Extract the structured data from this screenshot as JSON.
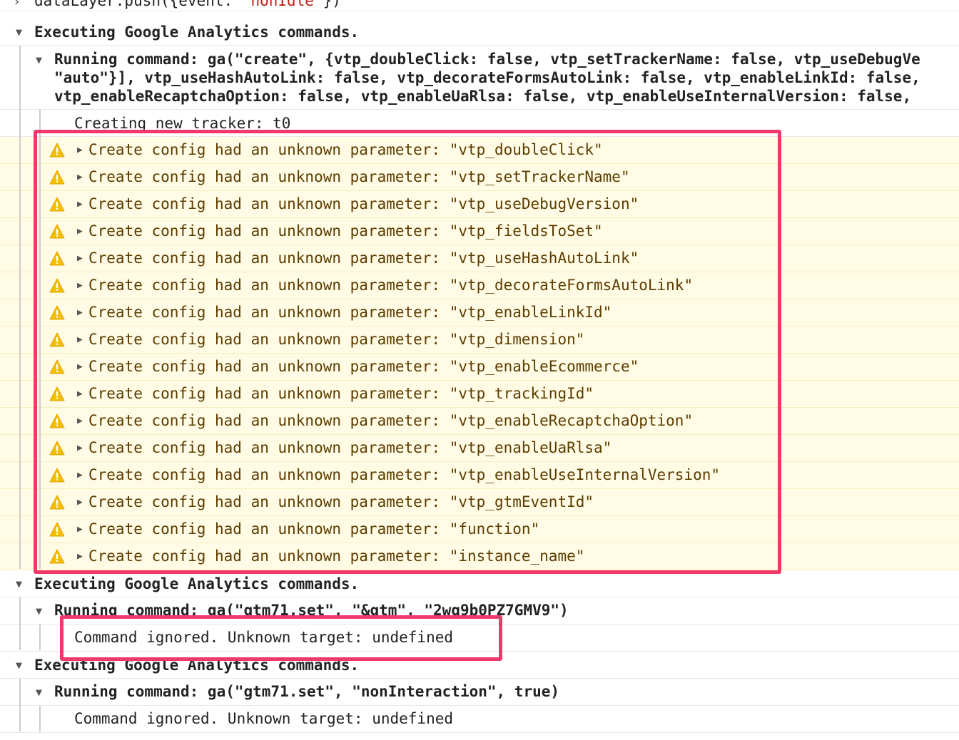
{
  "console": {
    "push_line": {
      "prefix": "dataLayer.push({event: ",
      "event": "'nonIdle'",
      "suffix": "})"
    },
    "groups": [
      {
        "header": "Executing Google Analytics commands.",
        "command_lines": [
          "Running command: ga(\"create\", {vtp_doubleClick: false, vtp_setTrackerName: false, vtp_useDebugVe",
          "\"auto\"}], vtp_useHashAutoLink: false, vtp_decorateFormsAutoLink: false, vtp_enableLinkId: false,",
          "vtp_enableRecaptchaOption: false, vtp_enableUaRlsa: false, vtp_enableUseInternalVersion: false,"
        ],
        "info": "Creating new tracker: t0",
        "warning_prefix": "Create config had an unknown parameter: ",
        "warnings": [
          "\"vtp_doubleClick\"",
          "\"vtp_setTrackerName\"",
          "\"vtp_useDebugVersion\"",
          "\"vtp_fieldsToSet\"",
          "\"vtp_useHashAutoLink\"",
          "\"vtp_decorateFormsAutoLink\"",
          "\"vtp_enableLinkId\"",
          "\"vtp_dimension\"",
          "\"vtp_enableEcommerce\"",
          "\"vtp_trackingId\"",
          "\"vtp_enableRecaptchaOption\"",
          "\"vtp_enableUaRlsa\"",
          "\"vtp_enableUseInternalVersion\"",
          "\"vtp_gtmEventId\"",
          "\"function\"",
          "\"instance_name\""
        ]
      },
      {
        "header": "Executing Google Analytics commands.",
        "command": "Running command: ga(\"gtm71.set\", \"&gtm\", \"2wg9b0PZ7GMV9\")",
        "info": "Command ignored. Unknown target: undefined"
      },
      {
        "header": "Executing Google Analytics commands.",
        "command": "Running command: ga(\"gtm71.set\", \"nonInteraction\", true)",
        "info": "Command ignored. Unknown target: undefined"
      }
    ]
  },
  "colors": {
    "warning_bg": "#fffbe5",
    "warning_text": "#5c3c00",
    "highlight": "#f0386b",
    "string_red": "#c41a16"
  },
  "icons": {
    "expand": "triangle-right",
    "collapse": "triangle-down",
    "warning": "warning-triangle",
    "prompt": "chevron-right"
  }
}
